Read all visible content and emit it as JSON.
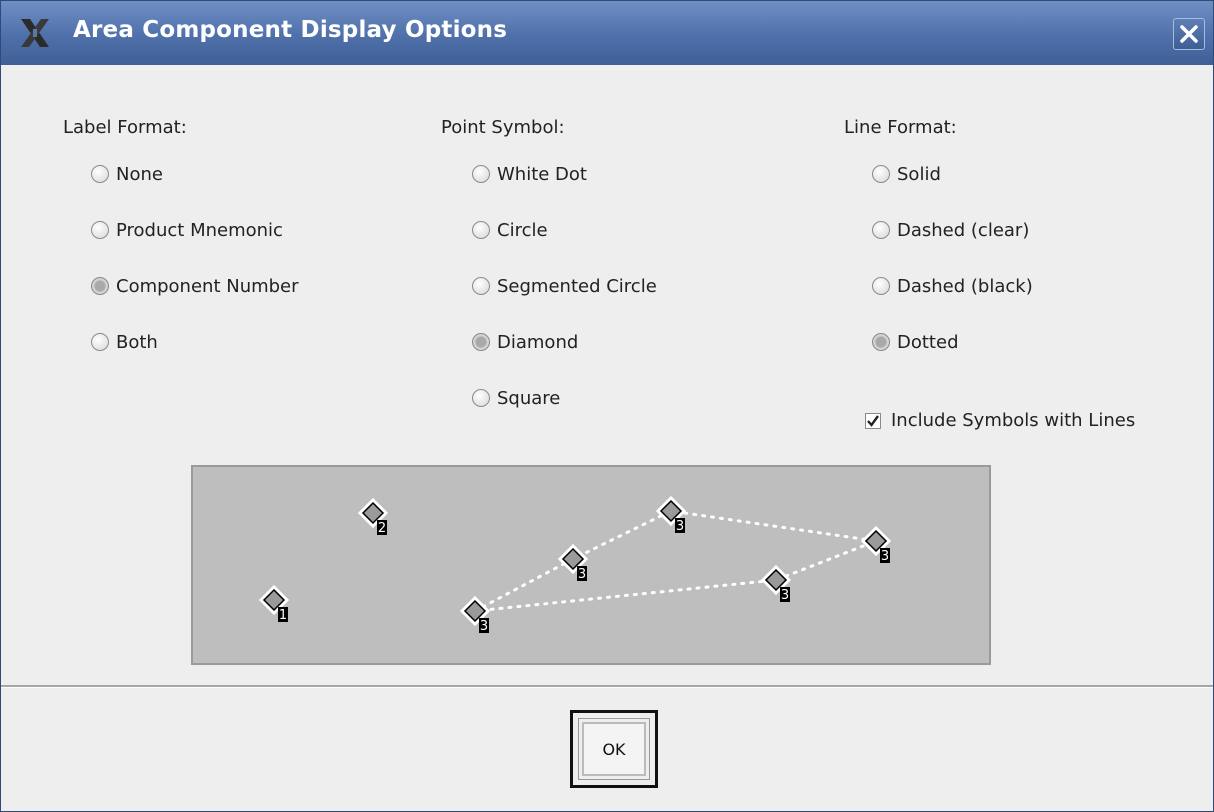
{
  "window": {
    "title": "Area Component Display Options",
    "close_icon": "close-icon",
    "app_icon": "x-logo-icon"
  },
  "label_format": {
    "heading": "Label Format:",
    "options": [
      "None",
      "Product Mnemonic",
      "Component Number",
      "Both"
    ],
    "selected": "Component Number"
  },
  "point_symbol": {
    "heading": "Point Symbol:",
    "options": [
      "White Dot",
      "Circle",
      "Segmented Circle",
      "Diamond",
      "Square"
    ],
    "selected": "Diamond"
  },
  "line_format": {
    "heading": "Line Format:",
    "options": [
      "Solid",
      "Dashed (clear)",
      "Dashed (black)",
      "Dotted"
    ],
    "selected": "Dotted"
  },
  "include_symbols": {
    "label": "Include Symbols with Lines",
    "checked": true
  },
  "preview": {
    "symbols": [
      {
        "label": "1"
      },
      {
        "label": "2"
      },
      {
        "label": "3"
      },
      {
        "label": "3"
      },
      {
        "label": "3"
      },
      {
        "label": "3"
      },
      {
        "label": "3"
      }
    ],
    "colors": {
      "background": "#bebebe",
      "symbol_fill": "#9a9a9a",
      "line": "#ffffff"
    }
  },
  "footer": {
    "ok_label": "OK"
  }
}
